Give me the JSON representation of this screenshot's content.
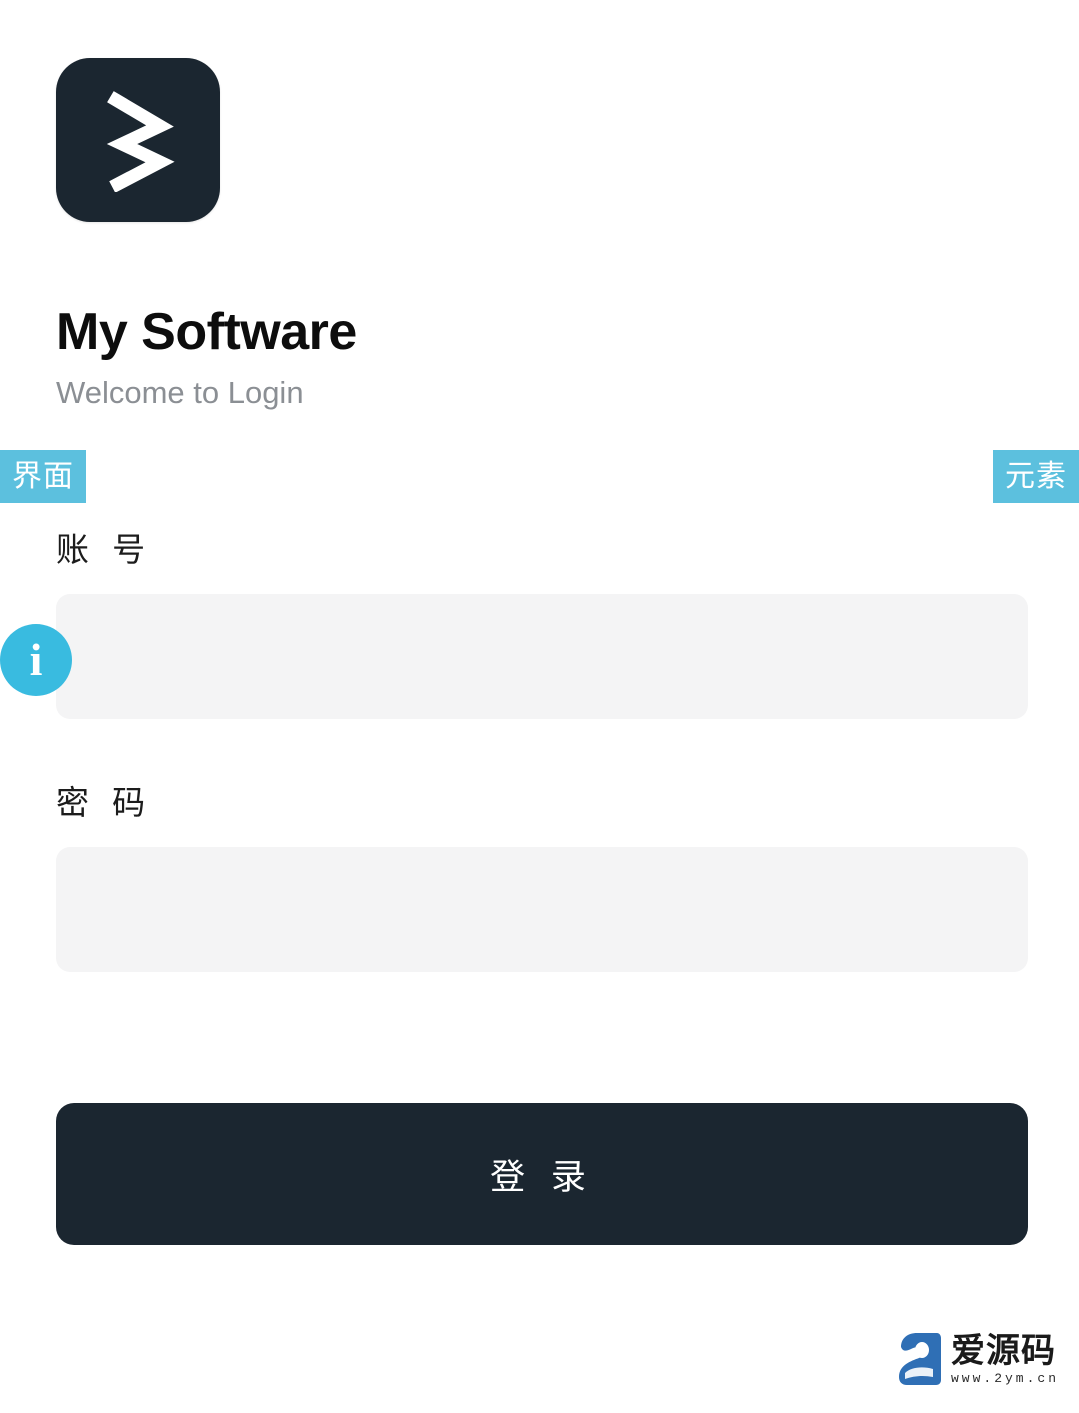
{
  "app": {
    "logo_icon": "zigzag-z-mark",
    "title": "My Software",
    "subtitle": "Welcome to Login"
  },
  "annotations": {
    "left_tag": "界面",
    "right_tag": "元素",
    "info_badge_icon": "info-icon",
    "info_badge_glyph": "i"
  },
  "form": {
    "account": {
      "label": "账 号",
      "value": "",
      "placeholder": ""
    },
    "password": {
      "label": "密 码",
      "value": "",
      "placeholder": ""
    },
    "submit_label": "登 录"
  },
  "watermark": {
    "name": "爱源码",
    "url": "www.2ym.cn",
    "mark_icon": "aiyuanma-bird-logo"
  },
  "colors": {
    "brand_dark": "#1b2630",
    "tag_blue": "#5cc0de",
    "badge_blue": "#39bbe0",
    "field_bg": "#f4f4f5",
    "title_text": "#0d0d0d",
    "subtitle_text": "#8b8f94",
    "watermark_blue": "#2f6fb5",
    "page_bg": "#ffffff"
  }
}
